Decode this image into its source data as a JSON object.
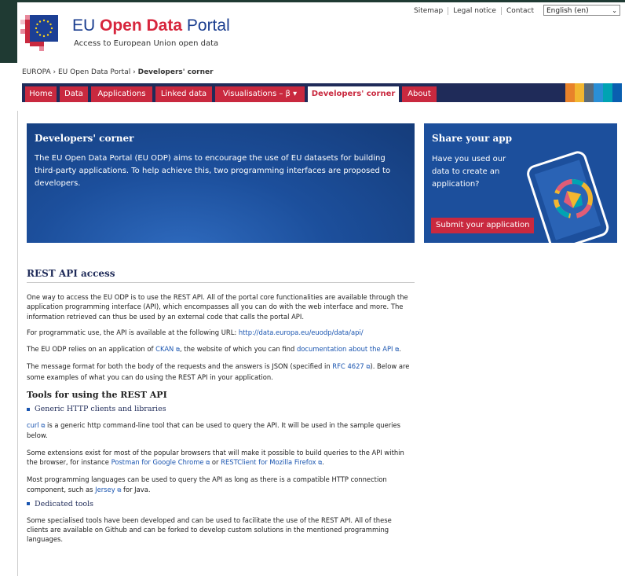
{
  "header": {
    "title_part1": "EU ",
    "title_part2": "Open Data",
    "title_part3": " Portal",
    "subtitle": "Access to European Union open data",
    "top_links": [
      "Sitemap",
      "Legal notice",
      "Contact"
    ],
    "language": "English (en)"
  },
  "breadcrumb": {
    "items": [
      "EUROPA",
      "EU Open Data Portal",
      "Developers' corner"
    ],
    "separator": "›"
  },
  "nav": {
    "tabs": [
      "Home",
      "Data",
      "Applications",
      "Linked data",
      "Visualisations – β ▾",
      "Developers' corner",
      "About"
    ],
    "active": "Developers' corner"
  },
  "hero": {
    "title": "Developers' corner",
    "text": "The EU Open Data Portal (EU ODP) aims to encourage the use of EU datasets for building third-party applications. To help achieve this, two programming interfaces are proposed to developers."
  },
  "share": {
    "title": "Share your app",
    "text": "Have you used our data to create an application?",
    "button": "Submit your application"
  },
  "content": {
    "heading": "REST API access",
    "p1": "One way to access the EU ODP is to use the REST API. All of the portal core functionalities are available through the application programming interface (API), which encompasses all you can do with the web interface and more. The information retrieved can thus be used by an external code that calls the portal API.",
    "p2_text": "For programmatic use, the API is available at the following URL: ",
    "p2_link": "http://data.europa.eu/euodp/data/api/",
    "p3_a": "The EU ODP relies on an application of ",
    "p3_link1": "CKAN",
    "p3_b": ", the website of which you can find ",
    "p3_link2": "documentation about the API",
    "p3_c": ".",
    "p4_a": "The message format for both the body of the requests and the answers is JSON (specified in ",
    "p4_link": "RFC 4627",
    "p4_b": "). Below are some examples of what you can do using the REST API in your application.",
    "tools_heading": "Tools for using the REST API",
    "sub1": "Generic HTTP clients and libraries",
    "p5_link": "curl",
    "p5_text": " is a generic http command-line tool that can be used to query the API. It will be used in the sample queries below.",
    "p6_a": "Some extensions exist for most of the popular browsers that will make it possible to build queries to the API within the browser, for instance ",
    "p6_link1": "Postman for Google Chrome",
    "p6_b": " or ",
    "p6_link2": "RESTClient for Mozilla Firefox",
    "p6_c": ".",
    "p7_a": "Most programming languages can be used to query the API as long as there is a compatible HTTP connection component, such as ",
    "p7_link": "Jersey",
    "p7_b": " for Java.",
    "sub2": "Dedicated tools",
    "p8": "Some specialised tools have been developed and can be used to facilitate the use of the REST API. All of these clients are available on Github and can be forked to develop custom solutions in the mentioned programming languages."
  },
  "colors": {
    "nav_bg": "#1f2b59",
    "tab_bg": "#c9293f",
    "hero_bg": "#1c4f9c",
    "link": "#1a55b0",
    "stripes": [
      "#e8822a",
      "#f2b630",
      "#5a6b7a",
      "#2a8fd6",
      "#00a3b3",
      "#0a5fb0",
      "#e8822a"
    ]
  },
  "icons": [
    "eu-flag-logo-icon",
    "external-link-icon",
    "chevron-down-icon",
    "tablet-app-illustration-icon"
  ]
}
